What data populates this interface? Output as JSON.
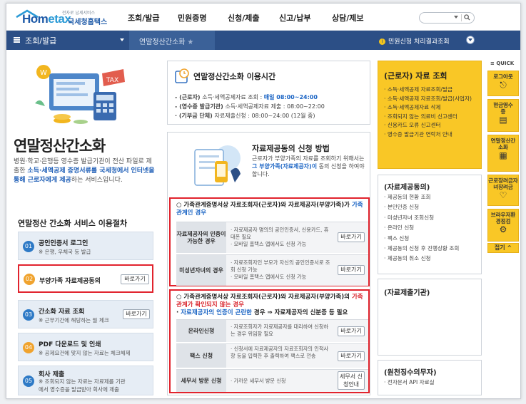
{
  "header": {
    "logo_text_a": "Hom",
    "logo_text_b": "etax",
    "logo_small": "전자로 납세서비스",
    "logo_kr": "국세청홈택스",
    "menu": [
      "조회/발급",
      "민원증명",
      "신청/제출",
      "신고/납부",
      "상담/제보"
    ],
    "search_icon": "search-icon"
  },
  "navbar": {
    "menu_label": "조회/발급",
    "submenu": "연말정산간소화",
    "right_link": "민원신청 처리결과조회",
    "right_icon": "i"
  },
  "hero": {
    "title": "연말정산간소화",
    "desc_1": "병원·학교·은행등 영수증 발급기관이 전산 파일로 제출한 ",
    "desc_hl1": "소득·세액공제 증명서류를 국세청에서",
    "desc_2": " ",
    "desc_hl2": "인터넷을 통해 근로자에게 제공",
    "desc_3": "하는 서비스입니다."
  },
  "procedure": {
    "title": "연말정산 간소화 서비스 이용절차",
    "steps": [
      {
        "num": "01",
        "title": "공인인증서 로그인",
        "sub": "※ 은행, 우체국 등 발급"
      },
      {
        "num": "02",
        "title": "부양가족 자료제공동의",
        "button": "바로가기"
      },
      {
        "num": "03",
        "title": "간소화 자료 조회",
        "sub": "※ 근무기간에 해당하는 월 체크",
        "button": "바로가기"
      },
      {
        "num": "04",
        "title": "PDF 다운로드 및 인쇄",
        "sub": "※ 공제요건에 맞지 않는 자료는 체크해제"
      },
      {
        "num": "05",
        "title": "회사 제출",
        "sub": "※ 조회되지 않는 자료는 자료제를 기관",
        "sub2": "에서 영수증을 발급받아 회사에 제출"
      }
    ]
  },
  "timebox": {
    "title": "연말정산간소화 이용시간",
    "lines": [
      {
        "a": "- (근로자) ",
        "b": "소득·세액공제자료 조회 : ",
        "c": "매일 08:00~24:00"
      },
      {
        "a": "- (영수증 발급기관) ",
        "b": "소득·세액공제자료 제출 : 08:00~22:00"
      },
      {
        "a": "  · (기부금 단체) ",
        "b": "자료제출신청 : 08:00~24:00 (12월 중)"
      }
    ]
  },
  "method": {
    "title": "자료제공동의 신청 방법",
    "desc_1": "근로자가 부양가족의 자료를 조회하기 위해서는",
    "desc_hl": "그 부양가족(자료제공자)이",
    "desc_2": " 동의 신청을 하여야 합니다.",
    "box1": {
      "title_1": "○ 가족관계증명서상 자료조회자(근로자)와 자료제공자(부양가족)가",
      "title_hl": "가족관계인 경우",
      "rows": [
        {
          "label": "자료제공자의 인증이 가능한 경우",
          "text": "· 자료제공자 명의의 공인인증서, 신용카드, 휴대폰 필요\n· 모바일 홈택스 앱에서도 신청 가능",
          "button": "바로가기"
        },
        {
          "label": "미성년자녀의 경우",
          "text": "· 자료조회자인 부모가 자신의 공인인증서로 조회 신청 가능\n· 모바일 홈택스 앱에서도 신청 가능",
          "button": "바로가기"
        }
      ]
    },
    "box2": {
      "title_1": "○ 가족관계증명서상 자료조회자(근로자)와 자료제공자(부양가족)의 ",
      "title_red": "가족관계가 확인되지 않는 경우",
      "title_2": "  · ",
      "title_hl": "자료제공자의 인증이 곤란한",
      "title_3": " 경우 ⇒ 자료제공자의 신분증 등 필요",
      "rows": [
        {
          "label": "온라인신청",
          "text": "· 자료조회자가 자료제공자를 대리하여 신청하는 경우 위임장 필요",
          "button": "바로가기"
        },
        {
          "label": "팩스 신청",
          "text": "· 신청서에 자료제공자의 자료조회자의 인적사항 등을 입력한 후 출력하여 팩스로 전송",
          "button": "바로가기"
        },
        {
          "label": "세무서 방문 신청",
          "text": "· 가까운 세무서 방문 신청",
          "button": "세무서 신청안내"
        }
      ]
    }
  },
  "employee": {
    "title": "(근로자) 자료 조회",
    "items": [
      "소득·세액공제 자료조회/발급",
      "소득·세액공제 자료조회/발급(사업자)",
      "소득·세액공제자료 삭제",
      "조회되지 않는 의료비 신고센터",
      "신용카드 오류 신고센터",
      "영수증 발급기관 연락처 안내"
    ]
  },
  "provider": {
    "title": "(자료제공동의)",
    "items": [
      "제공동의 현황 조회",
      "본인인증 신청",
      "미성년자녀 조회신청",
      "온라인 신청",
      "팩스 신청",
      "제공동의 신청 후 진행상황 조회",
      "제공동의 취소 신청"
    ]
  },
  "submitter": {
    "title": "(자료제출기관)"
  },
  "withholding": {
    "title": "(원천징수의무자)",
    "items": [
      "전자문서 API 자료실"
    ]
  },
  "quick": {
    "header": "QUICK",
    "items": [
      {
        "label": "로그아웃",
        "icon": "logout-icon",
        "glyph": "⎋"
      },
      {
        "label": "현금영수증",
        "icon": "receipt-icon",
        "glyph": "▤"
      },
      {
        "label": "연말정산간소화",
        "icon": "document-icon",
        "glyph": "▦"
      },
      {
        "label": "근로장려금자녀장려금",
        "icon": "heart-icon",
        "glyph": "♡"
      },
      {
        "label": "브라우저환경점검",
        "icon": "gear-icon",
        "glyph": "⚙"
      }
    ],
    "close": "접기 ^"
  },
  "colors": {
    "accent_blue": "#2c4f86",
    "yellow": "#f9c726",
    "red_box": "#e1232d"
  }
}
